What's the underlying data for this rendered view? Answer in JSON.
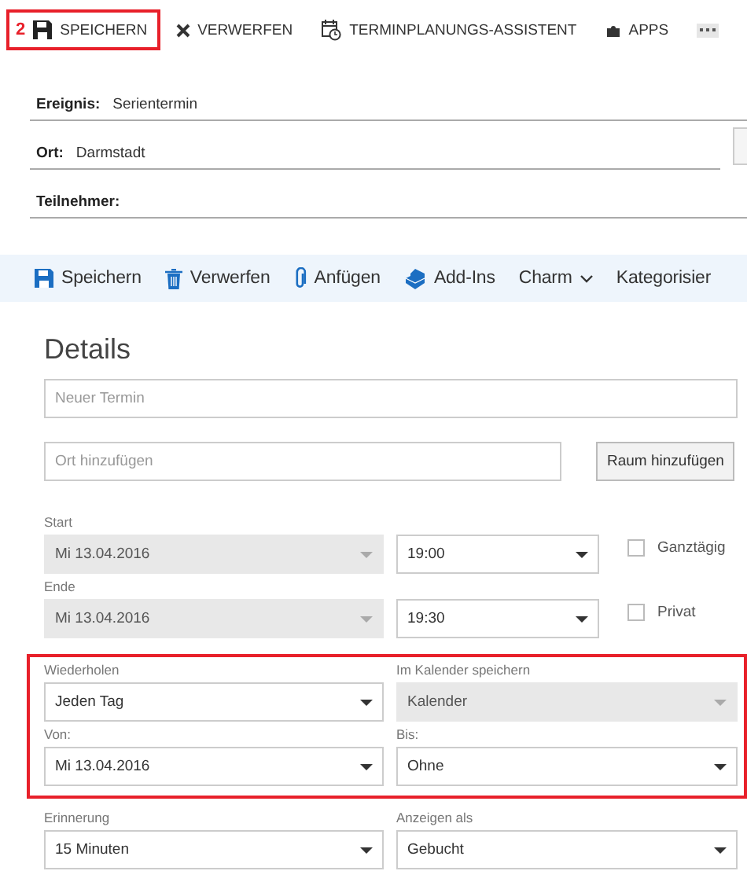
{
  "classic_toolbar": {
    "step_badge": "2",
    "buttons": [
      {
        "label": "SPEICHERN",
        "highlighted": true
      },
      {
        "label": "VERWERFEN",
        "highlighted": false
      },
      {
        "label": "TERMINPLANUNGS-ASSISTENT",
        "highlighted": false
      },
      {
        "label": "APPS",
        "highlighted": false
      }
    ]
  },
  "classic_form": {
    "fields": [
      {
        "label": "Ereignis:",
        "value": "Serientermin"
      },
      {
        "label": "Ort:",
        "value": "Darmstadt"
      },
      {
        "label": "Teilnehmer:"
      }
    ]
  },
  "web_toolbar": {
    "items": [
      {
        "label": "Speichern",
        "dropdown": false
      },
      {
        "label": "Verwerfen",
        "dropdown": false
      },
      {
        "label": "Anfügen",
        "dropdown": false
      },
      {
        "label": "Add-Ins",
        "dropdown": false
      },
      {
        "label": "Charm",
        "dropdown": true
      },
      {
        "label": "Kategorisier",
        "dropdown": false
      }
    ]
  },
  "details": {
    "heading": "Details",
    "title_field": {
      "placeholder": "Neuer Termin"
    },
    "location_field": {
      "placeholder": "Ort hinzufügen"
    },
    "room_button": "Raum hinzufügen"
  },
  "form_groups": [
    {
      "highlighted": false,
      "rows": [
        {
          "fields": [
            {
              "label": "Start",
              "value": "Mi 13.04.2016",
              "disabled": true
            },
            {
              "value": "19:00",
              "disabled": false
            }
          ],
          "checkbox": {
            "label": "Ganztägig",
            "checked": false
          }
        },
        {
          "fields": [
            {
              "label": "Ende",
              "value": "Mi 13.04.2016",
              "disabled": true
            },
            {
              "value": "19:30",
              "disabled": false
            }
          ],
          "checkbox": {
            "label": "Privat",
            "checked": false
          }
        }
      ]
    },
    {
      "highlighted": true,
      "rows": [
        {
          "fields": [
            {
              "label": "Wiederholen",
              "value": "Jeden Tag",
              "disabled": false
            },
            {
              "label": "Im Kalender speichern",
              "value": "Kalender",
              "disabled": true
            }
          ]
        },
        {
          "fields": [
            {
              "label": "Von:",
              "value": "Mi 13.04.2016",
              "disabled": false
            },
            {
              "label": "Bis:",
              "value": "Ohne",
              "disabled": false
            }
          ]
        }
      ]
    },
    {
      "highlighted": false,
      "rows": [
        {
          "fields": [
            {
              "label": "Erinnerung",
              "value": "15 Minuten",
              "disabled": false
            },
            {
              "label": "Anzeigen als",
              "value": "Gebucht",
              "disabled": false
            }
          ]
        }
      ]
    }
  ]
}
